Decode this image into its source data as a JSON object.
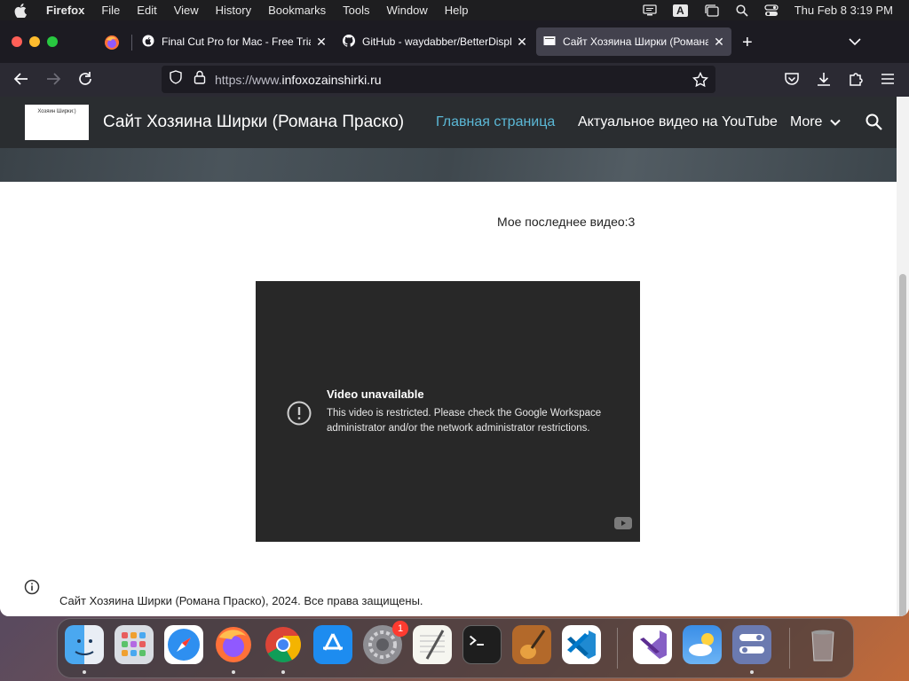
{
  "menubar": {
    "app": "Firefox",
    "items": [
      "File",
      "Edit",
      "View",
      "History",
      "Bookmarks",
      "Tools",
      "Window",
      "Help"
    ],
    "input_source": "A",
    "clock": "Thu Feb 8  3:19 PM"
  },
  "tabs": [
    {
      "title": "Final Cut Pro for Mac - Free Trial",
      "icon": "apple-icon"
    },
    {
      "title": "GitHub - waydabber/BetterDisplay",
      "icon": "github-icon"
    },
    {
      "title": "Сайт Хозяина Ширки (Романа Праско)",
      "icon": "page-icon",
      "active": true
    }
  ],
  "urlbar": {
    "prefix": "https://www.",
    "domain": "infoxozainshirki.ru"
  },
  "site": {
    "logo_text": "Хозяин Ширки:)",
    "title": "Сайт Хозяина Ширки (Романа Праско)",
    "nav": {
      "home": "Главная страница",
      "videos": "Актуальное видео на YouTube",
      "more": "More"
    },
    "latest_label": "Мое последнее видео:3",
    "video": {
      "title": "Video unavailable",
      "message": "This video is restricted. Please check the Google Workspace administrator and/or the network administrator restrictions."
    },
    "footer": "Сайт Хозяина Ширки (Романа Праско), 2024. Все права защищены."
  },
  "dock": {
    "apps": [
      "Finder",
      "Launchpad",
      "Safari",
      "Firefox",
      "Chrome",
      "App Store",
      "System Settings",
      "TextEdit",
      "Terminal",
      "GarageBand",
      "Visual Studio Code",
      "Visual Studio",
      "Weather",
      "Control Center",
      "Trash"
    ],
    "settings_badge": "1"
  },
  "colors": {
    "accent_nav": "#5bb8d6",
    "header_bg": "#2a2d30",
    "video_bg": "#282828"
  }
}
